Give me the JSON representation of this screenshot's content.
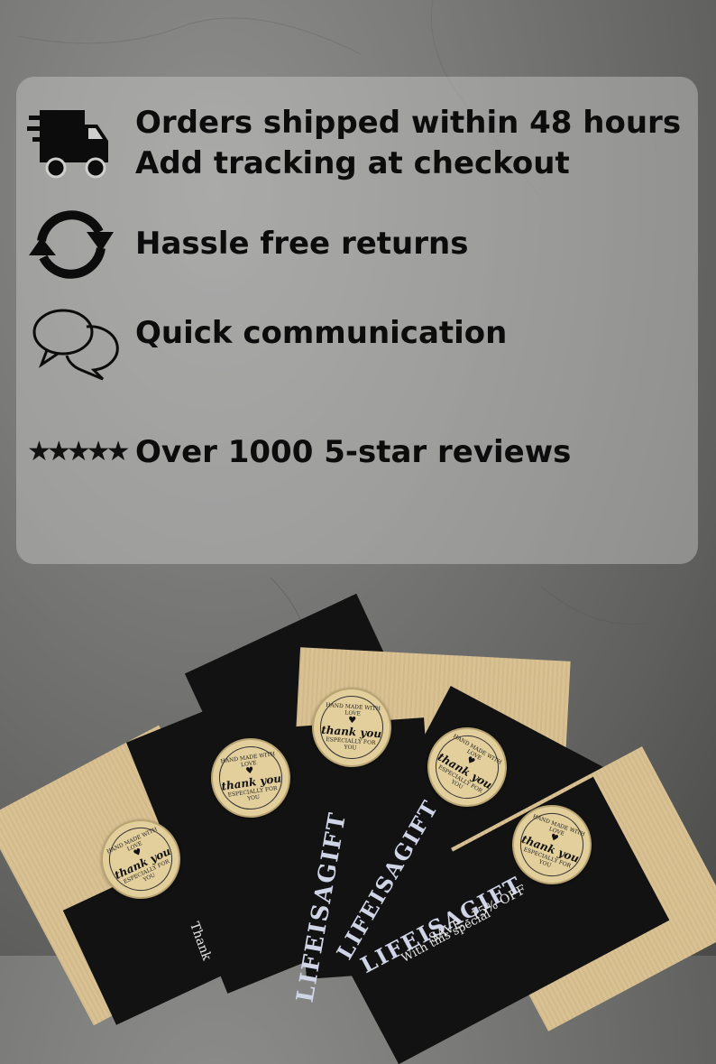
{
  "features": {
    "shipping_line1": "Orders shipped within 48 hours",
    "shipping_line2": "Add tracking at checkout",
    "returns": "Hassle free returns",
    "communication": "Quick communication",
    "reviews": "Over 1000 5-star reviews"
  },
  "icons": {
    "shipping": "delivery-truck-icon",
    "returns": "refresh-arrows-icon",
    "communication": "chat-bubbles-icon",
    "rating": "five-stars-icon"
  },
  "stars_glyphs": "★★★★★",
  "seal": {
    "top": "HAND MADE WITH LOVE",
    "middle": "thank you",
    "bottom": "ESPECIALLY FOR YOU"
  },
  "card": {
    "brand": "LIFEISAGIFT",
    "save_text": "SAVE - 15% OFF",
    "with_text": "With this special",
    "thanks_text": "Thank"
  },
  "colors": {
    "panel": "#cdcdcb",
    "text": "#0c0c0c",
    "kraft": "#d9c192",
    "envelope_black": "#121212"
  }
}
